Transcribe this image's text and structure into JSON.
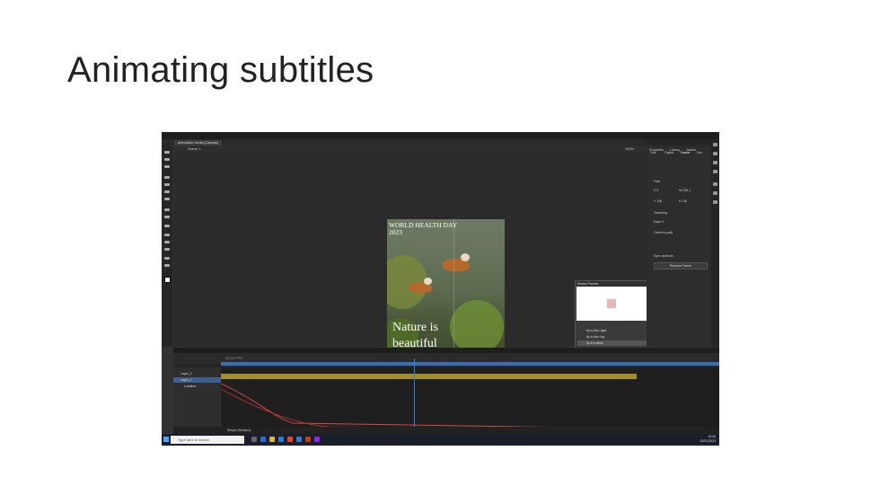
{
  "slide": {
    "title": "Animating subtitles"
  },
  "app": {
    "menu": [
      "Animate",
      "File",
      "Edit",
      "View",
      "Insert",
      "Modify",
      "Text",
      "Commands",
      "Control",
      "Debug",
      "Window",
      "Help"
    ],
    "doc_tab": "animation hd.fla [Canvas]",
    "scene": "Scene 1",
    "zoom": "100%"
  },
  "artboard": {
    "title_line1": "WORLD HEALTH DAY",
    "title_line2": "2023",
    "subtitle_line1": "Nature is",
    "subtitle_line2": "beautiful"
  },
  "motion_panel": {
    "title": "Motion Presets",
    "items": [
      "fly-in-blur-right",
      "fly-in-blur-top",
      "fly-in-bottom",
      "fly-in-left"
    ],
    "selected_index": 2,
    "apply": "Apply"
  },
  "properties": {
    "tabs": [
      "Properties",
      "Library",
      "Assets"
    ],
    "subtabs": [
      "Tool",
      "Object",
      "Frame",
      "Doc"
    ],
    "section_path": "Path",
    "x": "X 5",
    "w": "W 228.1",
    "y": "Y 108",
    "h": "H 118",
    "section_tweening": "Tweening",
    "ease": "Ease 0",
    "orient": "Orient to path",
    "sync": "Sync symbols",
    "remove": "Remove Tween"
  },
  "timeline": {
    "tabs": [
      "Timeline",
      "Output"
    ],
    "fps": "30.00 FPS",
    "layers": [
      "Layer_2",
      "Layer_1",
      "Location"
    ],
    "selected_layer": 1,
    "preset": "Simple (Medium)",
    "zoom": "100%"
  },
  "taskbar": {
    "search_placeholder": "Type here to search",
    "time": "13:40",
    "date": "03/01/2023"
  }
}
